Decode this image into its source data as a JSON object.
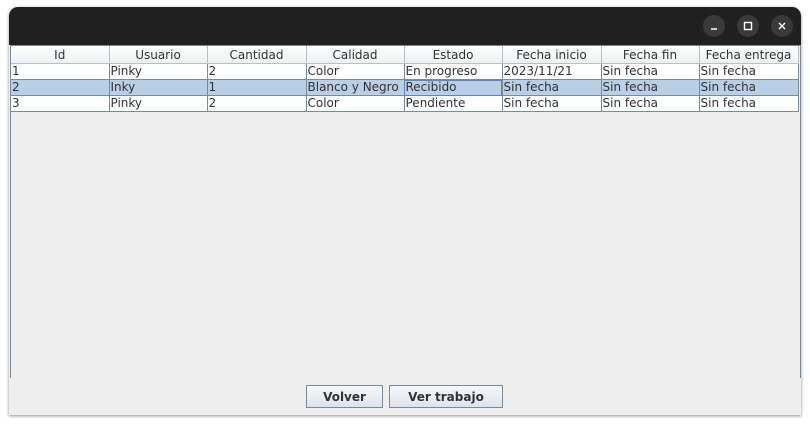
{
  "window": {
    "controls": [
      "minimize-icon",
      "maximize-icon",
      "close-icon"
    ]
  },
  "table": {
    "columns": [
      "Id",
      "Usuario",
      "Cantidad",
      "Calidad",
      "Estado",
      "Fecha inicio",
      "Fecha fin",
      "Fecha entrega"
    ],
    "rows": [
      [
        "1",
        "Pinky",
        "2",
        "Color",
        "En progreso",
        "2023/11/21",
        "Sin fecha",
        "Sin fecha"
      ],
      [
        "2",
        "Inky",
        "1",
        "Blanco y Negro",
        "Recibido",
        "Sin fecha",
        "Sin fecha",
        "Sin fecha"
      ],
      [
        "3",
        "Pinky",
        "2",
        "Color",
        "Pendiente",
        "Sin fecha",
        "Sin fecha",
        "Sin fecha"
      ]
    ],
    "selected_row": 1
  },
  "buttons": {
    "volver": "Volver",
    "ver_trabajo": "Ver trabajo"
  },
  "colors": {
    "titlebar": "#202020",
    "selection": "#b8cfe5",
    "grid": "#7a8a99"
  }
}
